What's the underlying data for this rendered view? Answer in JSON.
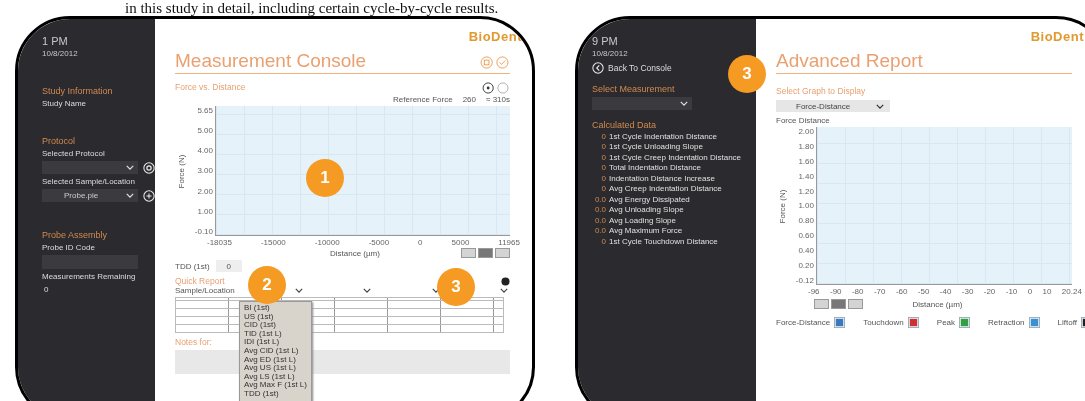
{
  "caption": "in this study in detail, including certain cycle-by-cycle results.",
  "measurement_console": {
    "sidebar": [
      {
        "kind": "time",
        "text": "1 PM"
      },
      {
        "kind": "date",
        "text": "10/8/2012"
      },
      {
        "kind": "heading",
        "text": "Study Information"
      },
      {
        "kind": "label",
        "text": "Study Name"
      },
      {
        "kind": "heading",
        "text": "Protocol"
      },
      {
        "kind": "label",
        "text": "Selected Protocol"
      },
      {
        "kind": "dropdown",
        "settings_button": true
      },
      {
        "kind": "label",
        "text": "Selected Sample/Location"
      },
      {
        "kind": "dropdown",
        "text": "Probe.pie",
        "add_button": true
      },
      {
        "kind": "heading",
        "text": "Probe Assembly"
      },
      {
        "kind": "label",
        "text": "Probe ID Code"
      },
      {
        "kind": "field"
      },
      {
        "kind": "label",
        "text": "Measurements Remaining"
      },
      {
        "kind": "value",
        "text": "0"
      }
    ],
    "logo": "BioDent",
    "title": "Measurement Console",
    "chart_title": "Force vs. Distance",
    "reference": {
      "label": "Reference Force",
      "value": "260",
      "unit": "≈ 310s"
    },
    "chart": {
      "ylabel": "Force (N)",
      "xlabel": "Distance (µm)",
      "y_ticks": [
        "5.65",
        "5.00",
        "4.00",
        "3.00",
        "2.00",
        "1.00",
        "-0.10"
      ],
      "x_ticks": [
        "-18035",
        "-15000",
        "-10000",
        "-5000",
        "0",
        "5000",
        "11965"
      ]
    },
    "zoom_tools": [
      {
        "selected": false
      },
      {
        "selected": true
      },
      {
        "selected": false
      }
    ],
    "tdd": {
      "label": "TDD (1st)",
      "value": "0"
    },
    "quick_report": {
      "title": "Quick Report",
      "column_header": "Sample/Location",
      "menu": [
        "BI (1st)",
        "US (1st)",
        "CID (1st)",
        "TID (1st L)",
        "IDI (1st L)",
        "Avg CID (1st L)",
        "Avg ED (1st L)",
        "Avg US (1st L)",
        "Avg LS (1st L)",
        "Avg Max F (1st L)",
        "TDD (1st)"
      ]
    },
    "notes_label": "Notes for:",
    "badges": [
      "1",
      "2",
      "3"
    ]
  },
  "advanced_report": {
    "sidebar": [
      {
        "kind": "time",
        "text": "9 PM"
      },
      {
        "kind": "date",
        "text": "10/8/2012"
      },
      {
        "kind": "back",
        "text": "Back To Console"
      },
      {
        "kind": "heading",
        "text": "Select Measurement"
      },
      {
        "kind": "dropdown"
      },
      {
        "kind": "heading",
        "text": "Calculated Data"
      },
      {
        "kind": "data",
        "value": "0",
        "text": "1st Cycle Indentation Distance"
      },
      {
        "kind": "data",
        "value": "0",
        "text": "1st Cycle Unloading Slope"
      },
      {
        "kind": "data",
        "value": "0",
        "text": "1st Cycle Creep Indentation Distance"
      },
      {
        "kind": "data",
        "value": "0",
        "text": "Total Indentation Distance"
      },
      {
        "kind": "data",
        "value": "0",
        "text": "Indentation Distance Increase"
      },
      {
        "kind": "data",
        "value": "0",
        "text": "Avg Creep Indentation Distance"
      },
      {
        "kind": "data",
        "value": "0.0",
        "text": "Avg Energy Dissipated"
      },
      {
        "kind": "data",
        "value": "0.0",
        "text": "Avg Unloading Slope"
      },
      {
        "kind": "data",
        "value": "0.0",
        "text": "Avg Loading Slope"
      },
      {
        "kind": "data",
        "value": "0.0",
        "text": "Avg Maximum Force"
      },
      {
        "kind": "data",
        "value": "0",
        "text": "1st Cycle Touchdown Distance"
      }
    ],
    "logo": "BioDent",
    "title": "Advanced Report",
    "badge": "3",
    "select_label": "Select Graph to Display",
    "select_value": "Force-Distance",
    "chart_title": "Force Distance",
    "chart": {
      "ylabel": "Force (N)",
      "xlabel": "Distance (µm)",
      "y_ticks": [
        "2.00",
        "1.80",
        "1.60",
        "1.40",
        "1.20",
        "1.00",
        "0.80",
        "0.60",
        "0.40",
        "0.20",
        "-0.12"
      ],
      "x_ticks": [
        "-96",
        "-90",
        "-80",
        "-70",
        "-60",
        "-50",
        "-40",
        "-30",
        "-20",
        "-10",
        "0",
        "10",
        "20.24"
      ]
    },
    "zoom_tools": [
      {
        "selected": false
      },
      {
        "selected": true
      },
      {
        "selected": false
      }
    ],
    "legend": [
      {
        "label": "Force-Distance",
        "color": "#3a78c0"
      },
      {
        "label": "Touchdown",
        "color": "#d03030"
      },
      {
        "label": "Peak",
        "color": "#30a040"
      },
      {
        "label": "Retraction",
        "color": "#3a90d0"
      },
      {
        "label": "Liftoff",
        "color": "#202020"
      }
    ]
  }
}
